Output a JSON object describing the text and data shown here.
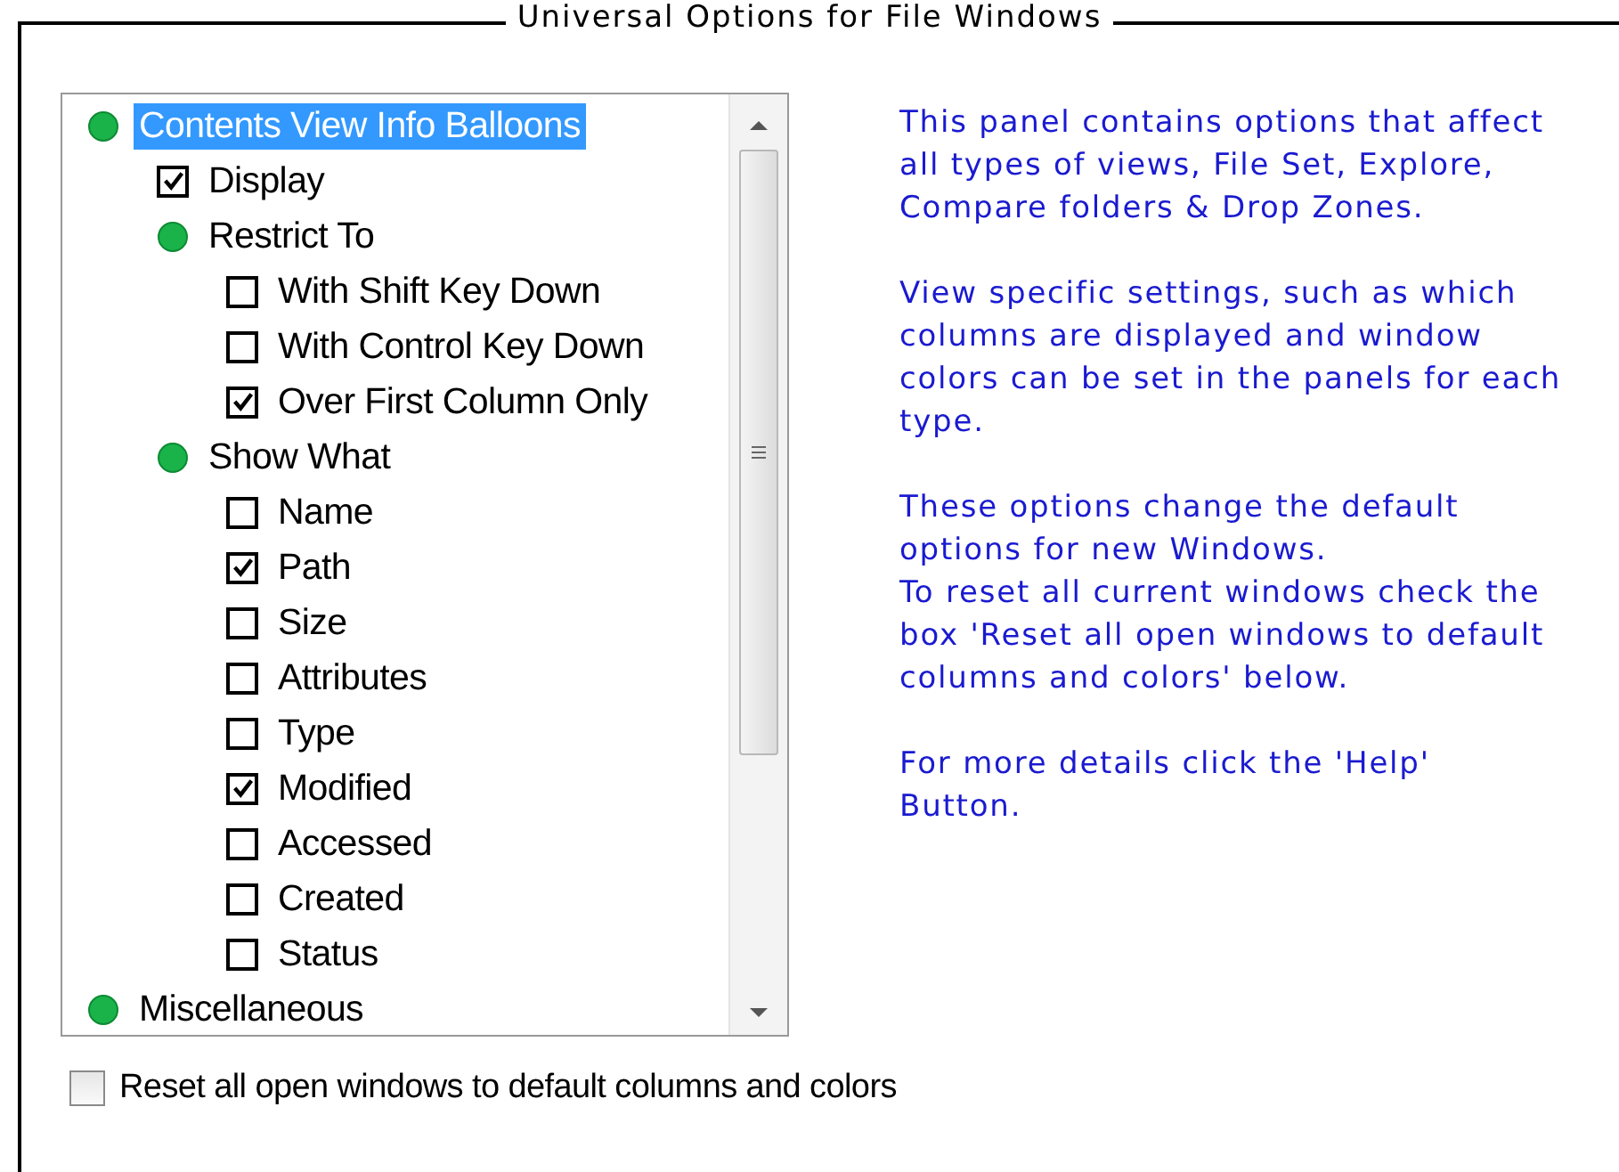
{
  "window": {
    "title": "Universal Options for File Windows"
  },
  "tree": [
    {
      "kind": "group",
      "label": "Contents View Info Balloons",
      "selected": true,
      "children": [
        {
          "kind": "check",
          "label": "Display",
          "checked": true,
          "selected": false
        },
        {
          "kind": "group",
          "label": "Restrict To",
          "selected": false,
          "children": [
            {
              "kind": "check",
              "label": "With Shift Key Down",
              "checked": false,
              "selected": false
            },
            {
              "kind": "check",
              "label": "With Control Key Down",
              "checked": false,
              "selected": false
            },
            {
              "kind": "check",
              "label": "Over First Column Only",
              "checked": true,
              "selected": false
            }
          ]
        },
        {
          "kind": "group",
          "label": "Show What",
          "selected": false,
          "children": [
            {
              "kind": "check",
              "label": "Name",
              "checked": false,
              "selected": false
            },
            {
              "kind": "check",
              "label": "Path",
              "checked": true,
              "selected": false
            },
            {
              "kind": "check",
              "label": "Size",
              "checked": false,
              "selected": false
            },
            {
              "kind": "check",
              "label": "Attributes",
              "checked": false,
              "selected": false
            },
            {
              "kind": "check",
              "label": "Type",
              "checked": false,
              "selected": false
            },
            {
              "kind": "check",
              "label": "Modified",
              "checked": true,
              "selected": false
            },
            {
              "kind": "check",
              "label": "Accessed",
              "checked": false,
              "selected": false
            },
            {
              "kind": "check",
              "label": "Created",
              "checked": false,
              "selected": false
            },
            {
              "kind": "check",
              "label": "Status",
              "checked": false,
              "selected": false
            }
          ]
        }
      ]
    },
    {
      "kind": "group",
      "label": "Miscellaneous",
      "selected": false
    }
  ],
  "help_text": [
    "This panel contains options that affect all types of views, File Set, Explore, Compare folders & Drop Zones.",
    "View specific settings, such as which columns are displayed and window colors can be set in the panels for each type.",
    "These options change the default options for new Windows.\nTo reset all current windows check the box 'Reset all open windows to default columns and colors' below.",
    "For more details click the 'Help' Button."
  ],
  "reset_option": {
    "label": "Reset all open windows to default columns and colors",
    "checked": false
  }
}
